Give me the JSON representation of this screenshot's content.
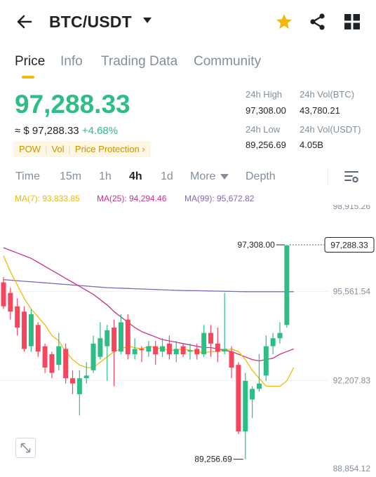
{
  "header": {
    "pair": "BTC/USDT",
    "back_icon": "arrow-left-icon",
    "favorite_icon": "star-icon",
    "share_icon": "share-icon",
    "menu_icon": "grid-icon"
  },
  "tabs": [
    "Price",
    "Info",
    "Trading Data",
    "Community"
  ],
  "price": {
    "last": "97,288.33",
    "approx": "≈ $ 97,288.33",
    "change": "+4.68%",
    "tags": [
      "POW",
      "Vol",
      "Price Protection ›"
    ]
  },
  "stats": {
    "high_label": "24h High",
    "high_value": "97,308.00",
    "volbtc_label": "24h Vol(BTC)",
    "volbtc_value": "43,780.21",
    "low_label": "24h Low",
    "low_value": "89,256.69",
    "volusdt_label": "24h Vol(USDT)",
    "volusdt_value": "4.05B"
  },
  "intervals": [
    "Time",
    "15m",
    "1h",
    "4h",
    "1d",
    "More",
    "Depth"
  ],
  "selected_interval": "4h",
  "ma": {
    "ma7": "MA(7): 93,833.85",
    "ma25": "MA(25): 94,294.46",
    "ma99": "MA(99): 95,672.82"
  },
  "colors": {
    "up": "#2ebd85",
    "down": "#f6465d",
    "accent": "#f0b90b",
    "ma7": "#f0b90b",
    "ma25": "#c8338a",
    "ma99": "#8467b5"
  },
  "chart_data": {
    "type": "candlestick",
    "y_ticks": [
      "98,915.26",
      "95,561.54",
      "92,207.83",
      "88,854.12"
    ],
    "ylim": [
      88854.12,
      98915.26
    ],
    "current_price_label": "97,288.33",
    "current_price": 97288.33,
    "high_label": "97,308.00",
    "high": 97308.0,
    "low_label": "89,256.69",
    "low": 89256.69,
    "candles": [
      {
        "o": 95900,
        "c": 95000,
        "h": 96100,
        "l": 94900
      },
      {
        "o": 95500,
        "c": 94800,
        "h": 95700,
        "l": 94500
      },
      {
        "o": 95000,
        "c": 94200,
        "h": 95300,
        "l": 93900
      },
      {
        "o": 94800,
        "c": 93400,
        "h": 95000,
        "l": 93300
      },
      {
        "o": 93500,
        "c": 94700,
        "h": 94900,
        "l": 93300
      },
      {
        "o": 94300,
        "c": 93300,
        "h": 94400,
        "l": 93100
      },
      {
        "o": 93500,
        "c": 92700,
        "h": 93600,
        "l": 92500
      },
      {
        "o": 93200,
        "c": 92500,
        "h": 93300,
        "l": 92300
      },
      {
        "o": 92800,
        "c": 93500,
        "h": 94000,
        "l": 92600
      },
      {
        "o": 93400,
        "c": 92300,
        "h": 93600,
        "l": 92100
      },
      {
        "o": 92300,
        "c": 92100,
        "h": 92600,
        "l": 91700
      },
      {
        "o": 91700,
        "c": 92300,
        "h": 92600,
        "l": 90900
      },
      {
        "o": 92300,
        "c": 92400,
        "h": 92900,
        "l": 92100
      },
      {
        "o": 92600,
        "c": 93600,
        "h": 93900,
        "l": 92500
      },
      {
        "o": 93100,
        "c": 93800,
        "h": 94400,
        "l": 93000
      },
      {
        "o": 93500,
        "c": 94100,
        "h": 94300,
        "l": 92200
      },
      {
        "o": 94200,
        "c": 93300,
        "h": 94500,
        "l": 92000
      },
      {
        "o": 93300,
        "c": 94400,
        "h": 94700,
        "l": 93200
      },
      {
        "o": 94500,
        "c": 93200,
        "h": 94700,
        "l": 93000
      },
      {
        "o": 93200,
        "c": 93400,
        "h": 93800,
        "l": 93000
      },
      {
        "o": 93400,
        "c": 93350,
        "h": 93500,
        "l": 92900
      },
      {
        "o": 93300,
        "c": 93500,
        "h": 93700,
        "l": 93100
      },
      {
        "o": 93500,
        "c": 93200,
        "h": 93700,
        "l": 92800
      },
      {
        "o": 93300,
        "c": 93500,
        "h": 93800,
        "l": 93100
      },
      {
        "o": 93600,
        "c": 93200,
        "h": 93900,
        "l": 93000
      },
      {
        "o": 93200,
        "c": 93400,
        "h": 93700,
        "l": 92900
      },
      {
        "o": 93500,
        "c": 93200,
        "h": 93600,
        "l": 93100
      },
      {
        "o": 93300,
        "c": 93350,
        "h": 93600,
        "l": 93000
      },
      {
        "o": 93400,
        "c": 93200,
        "h": 93600,
        "l": 93000
      },
      {
        "o": 93200,
        "c": 94000,
        "h": 94300,
        "l": 93100
      },
      {
        "o": 94000,
        "c": 93600,
        "h": 94300,
        "l": 93100
      },
      {
        "o": 93600,
        "c": 93300,
        "h": 94200,
        "l": 92900
      },
      {
        "o": 93300,
        "c": 93400,
        "h": 95500,
        "l": 93200
      },
      {
        "o": 93300,
        "c": 92700,
        "h": 93500,
        "l": 92300
      },
      {
        "o": 92800,
        "c": 90300,
        "h": 92900,
        "l": 90200
      },
      {
        "o": 90300,
        "c": 92200,
        "h": 92500,
        "l": 89256.69
      },
      {
        "o": 91500,
        "c": 91900,
        "h": 92000,
        "l": 90800
      },
      {
        "o": 91900,
        "c": 92100,
        "h": 93200,
        "l": 91800
      },
      {
        "o": 92400,
        "c": 93500,
        "h": 93900,
        "l": 92200
      },
      {
        "o": 93500,
        "c": 93800,
        "h": 94000,
        "l": 93200
      },
      {
        "o": 93800,
        "c": 94000,
        "h": 94400,
        "l": 93600
      },
      {
        "o": 94300,
        "c": 97288.33,
        "h": 97308.0,
        "l": 94200
      }
    ],
    "ma7": [
      96900,
      96300,
      95800,
      95300,
      94900,
      94600,
      94300,
      93900,
      93700,
      93300,
      93000,
      92800,
      92700,
      92700,
      92900,
      93100,
      93300,
      93400,
      93500,
      93450,
      93400,
      93500,
      93450,
      93400,
      93350,
      93350,
      93400,
      93350,
      93300,
      93250,
      93300,
      93300,
      93350,
      93400,
      93300,
      93000,
      92600,
      92300,
      92000,
      92000,
      92000,
      92200,
      92700
    ],
    "ma25": [
      97200,
      97100,
      97000,
      96900,
      96800,
      96650,
      96500,
      96350,
      96200,
      96050,
      95900,
      95750,
      95600,
      95450,
      95250,
      95050,
      94800,
      94600,
      94400,
      94200,
      94050,
      93950,
      93850,
      93750,
      93700,
      93650,
      93600,
      93550,
      93500,
      93450,
      93450,
      93400,
      93350,
      93300,
      93200,
      93100,
      93000,
      92950,
      93000,
      93050,
      93200,
      93300,
      93400
    ],
    "ma99": [
      96000,
      95980,
      95960,
      95940,
      95920,
      95900,
      95880,
      95860,
      95840,
      95820,
      95800,
      95780,
      95760,
      95740,
      95720,
      95700,
      95690,
      95680,
      95670,
      95660,
      95650,
      95640,
      95630,
      95620,
      95610,
      95600,
      95595,
      95590,
      95585,
      95580,
      95575,
      95570,
      95565,
      95560,
      95555,
      95550,
      95550,
      95550,
      95550,
      95550,
      95550,
      95550,
      95550
    ]
  }
}
